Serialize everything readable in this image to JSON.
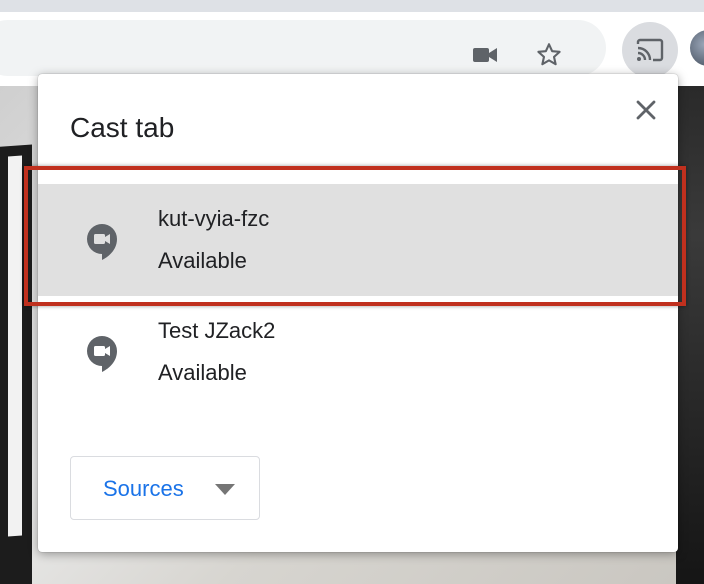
{
  "dialog": {
    "title": "Cast tab",
    "close_icon": "close-icon",
    "sinks": [
      {
        "name": "kut-vyia-fzc",
        "status": "Available",
        "icon": "hangouts-meet-icon",
        "selected": true
      },
      {
        "name": "Test JZack2",
        "status": "Available",
        "icon": "hangouts-meet-icon",
        "selected": false
      }
    ],
    "sources_label": "Sources"
  },
  "toolbar": {
    "icons": [
      "camera-icon",
      "star-icon",
      "cast-icon",
      "avatar"
    ]
  },
  "colors": {
    "accent": "#1a73e8",
    "highlight_border": "#c0301e",
    "selected_row": "#e0e0e0",
    "icon_gray": "#5f6368"
  }
}
